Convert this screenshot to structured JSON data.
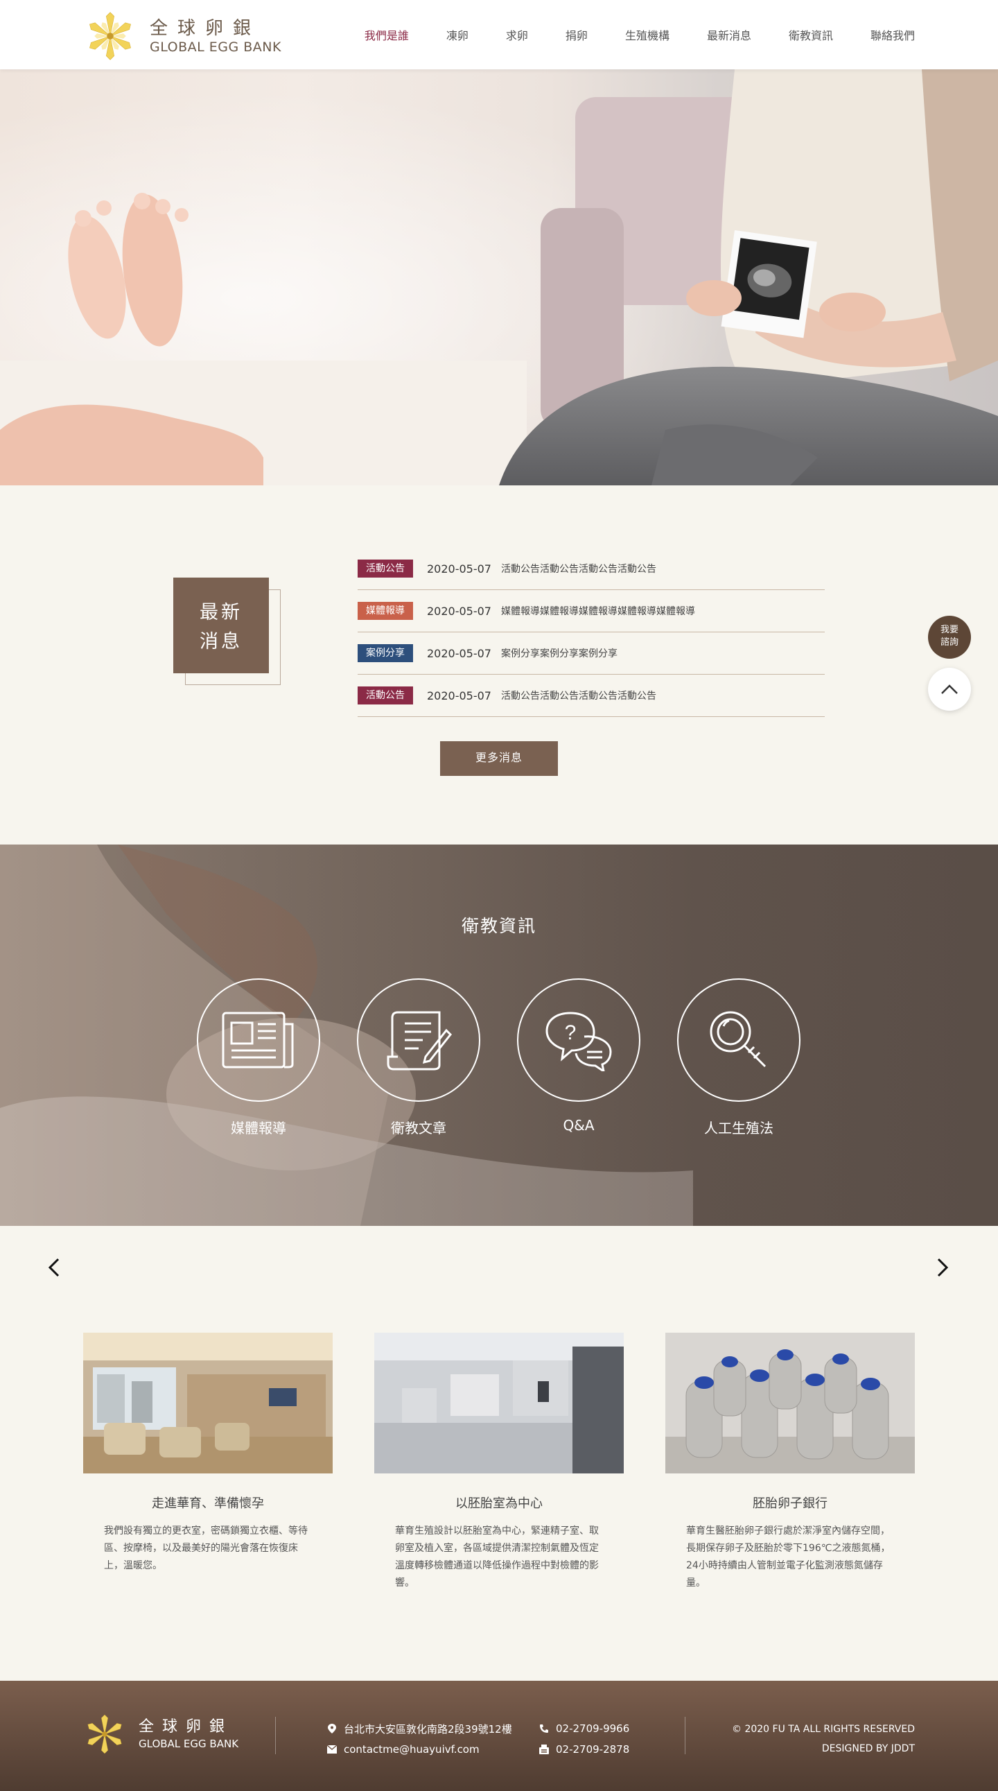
{
  "header": {
    "logo_cn": "全球卵銀",
    "logo_en": "GLOBAL EGG BANK",
    "nav": [
      {
        "label": "我們是誰",
        "active": true
      },
      {
        "label": "凍卵",
        "active": false
      },
      {
        "label": "求卵",
        "active": false
      },
      {
        "label": "捐卵",
        "active": false
      },
      {
        "label": "生殖機構",
        "active": false
      },
      {
        "label": "最新消息",
        "active": false
      },
      {
        "label": "衛教資訊",
        "active": false
      },
      {
        "label": "聯絡我們",
        "active": false
      }
    ]
  },
  "news": {
    "title_line1": "最新",
    "title_line2": "消息",
    "items": [
      {
        "tag": "活動公告",
        "tag_color": "#8b2a46",
        "date": "2020-05-07",
        "text": "活動公告活動公告活動公告活動公告"
      },
      {
        "tag": "媒體報導",
        "tag_color": "#c9614a",
        "date": "2020-05-07",
        "text": "媒體報導媒體報導媒體報導媒體報導媒體報導"
      },
      {
        "tag": "案例分享",
        "tag_color": "#2d4f7c",
        "date": "2020-05-07",
        "text": "案例分享案例分享案例分享"
      },
      {
        "tag": "活動公告",
        "tag_color": "#8b2a46",
        "date": "2020-05-07",
        "text": "活動公告活動公告活動公告活動公告"
      }
    ],
    "more_label": "更多消息"
  },
  "float": {
    "consult_line1": "我要",
    "consult_line2": "諮詢"
  },
  "edu": {
    "title": "衛教資訊",
    "items": [
      {
        "label": "媒體報導",
        "icon": "newspaper-icon"
      },
      {
        "label": "衛教文章",
        "icon": "article-icon"
      },
      {
        "label": "Q&A",
        "icon": "qa-icon"
      },
      {
        "label": "人工生殖法",
        "icon": "magnifier-icon"
      }
    ]
  },
  "features": [
    {
      "title": "走進華育、準備懷孕",
      "desc": "我們設有獨立的更衣室，密碼鎖獨立衣櫃、等待區、按摩椅，以及最美好的陽光會落在恢復床上，溫暖您。"
    },
    {
      "title": "以胚胎室為中心",
      "desc": "華育生殖設計以胚胎室為中心，緊連精子室、取卵室及植入室，各區域提供清潔控制氣體及恆定溫度轉移檢體通道以降低操作過程中對檢體的影響。"
    },
    {
      "title": "胚胎卵子銀行",
      "desc": "華育生醫胚胎卵子銀行處於潔淨室內儲存空間，長期保存卵子及胚胎於零下196℃之液態氮桶，24小時持續由人管制並電子化監測液態氮儲存量。"
    }
  ],
  "footer": {
    "logo_cn": "全球卵銀",
    "logo_en": "GLOBAL EGG BANK",
    "address": "台北市大安區敦化南路2段39號12樓",
    "email": "contactme@huayuivf.com",
    "phone": "02-2709-9966",
    "fax": "02-2709-2878",
    "copyright": "© 2020 FU TA ALL RIGHTS RESERVED",
    "designed_by": "DESIGNED BY JDDT"
  }
}
